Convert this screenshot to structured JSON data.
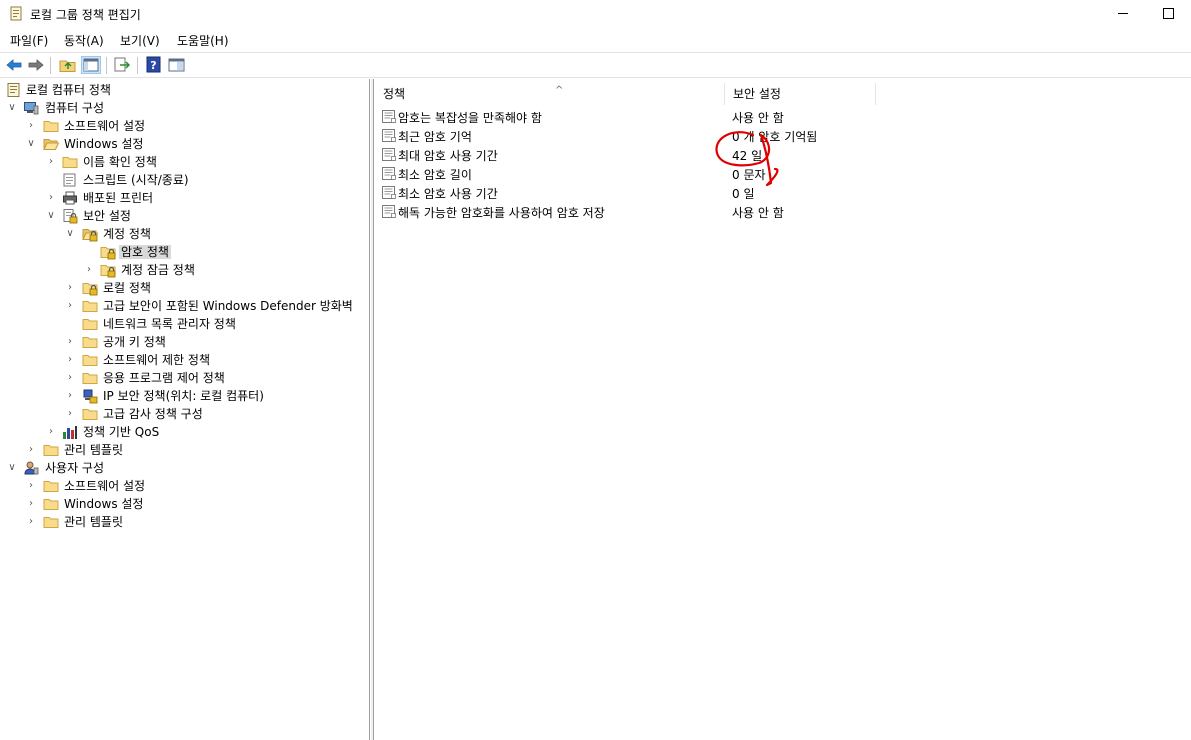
{
  "window": {
    "title": "로컬 그룹 정책 편집기"
  },
  "menu": [
    "파일(F)",
    "동작(A)",
    "보기(V)",
    "도움말(H)"
  ],
  "toolbar": {
    "buttons": [
      "back-arrow-icon",
      "forward-arrow-icon",
      "up-folder-icon",
      "show-hide-tree-icon",
      "export-list-icon",
      "help-icon",
      "properties-view-icon"
    ]
  },
  "tree": {
    "root": "로컬 컴퓨터 정책",
    "computer_config": "컴퓨터 구성",
    "software_settings": "소프트웨어 설정",
    "windows_settings": "Windows 설정",
    "name_resolution": "이름 확인 정책",
    "scripts": "스크립트 (시작/종료)",
    "deployed_printers": "배포된 프린터",
    "security_settings": "보안 설정",
    "account_policies": "계정 정책",
    "password_policy": "암호 정책",
    "account_lockout": "계정 잠금 정책",
    "local_policies": "로컬 정책",
    "defender_firewall": "고급 보안이 포함된 Windows Defender 방화벽",
    "network_list": "네트워크 목록 관리자 정책",
    "public_key": "공개 키 정책",
    "software_restriction": "소프트웨어 제한 정책",
    "app_control": "응용 프로그램 제어 정책",
    "ip_security": "IP 보안 정책(위치: 로컬 컴퓨터)",
    "advanced_audit": "고급 감사 정책 구성",
    "qos": "정책 기반 QoS",
    "admin_templates": "관리 템플릿",
    "user_config": "사용자 구성",
    "user_software_settings": "소프트웨어 설정",
    "user_windows_settings": "Windows 설정",
    "user_admin_templates": "관리 템플릿"
  },
  "list": {
    "headers": {
      "policy": "정책",
      "setting": "보안 설정"
    },
    "rows": [
      {
        "policy": "암호는 복잡성을 만족해야 함",
        "setting": "사용 안 함"
      },
      {
        "policy": "최근 암호 기억",
        "setting": "0 개 암호 기억됨"
      },
      {
        "policy": "최대 암호 사용 기간",
        "setting": "42 일"
      },
      {
        "policy": "최소 암호 길이",
        "setting": "0 문자"
      },
      {
        "policy": "최소 암호 사용 기간",
        "setting": "0 일"
      },
      {
        "policy": "해독 가능한 암호화를 사용하여 암호 저장",
        "setting": "사용 안 함"
      }
    ]
  },
  "colors": {
    "selection": "#d9d9d9",
    "annotation": "#e00000",
    "folder": "#f4d27a"
  }
}
